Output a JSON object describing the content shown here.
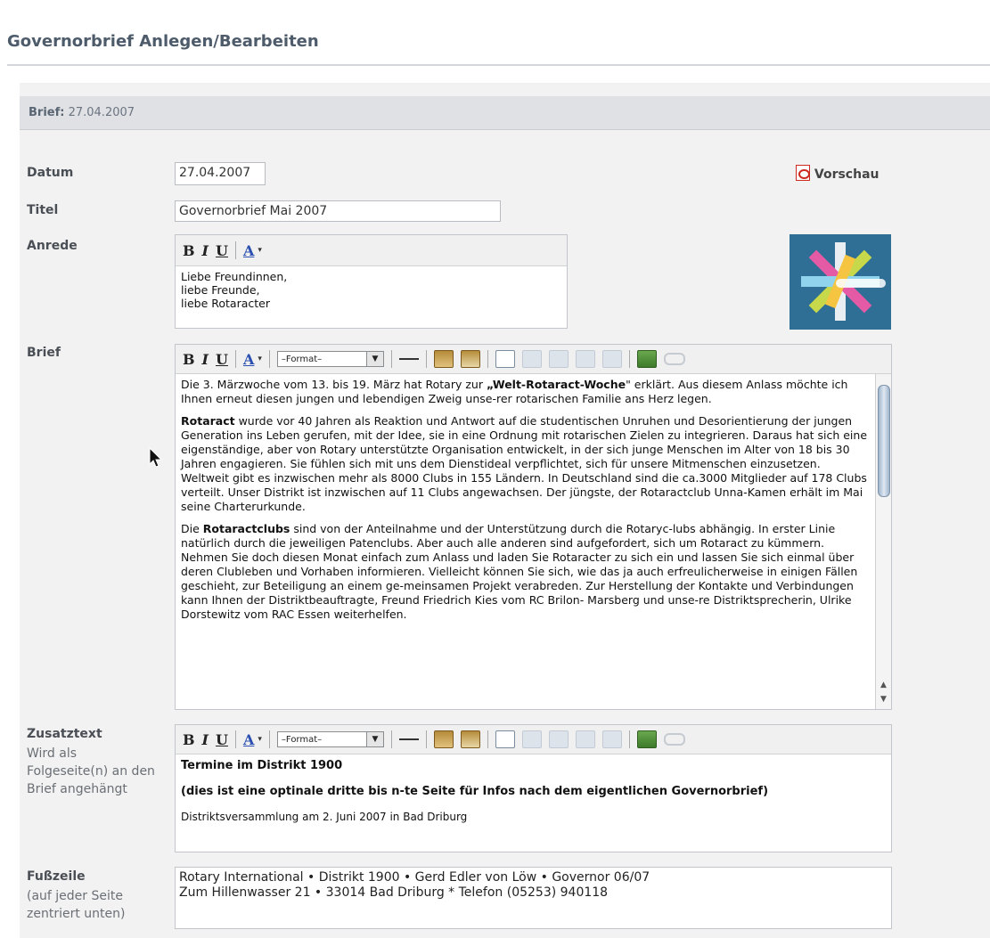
{
  "page": {
    "title": "Governorbrief Anlegen/Bearbeiten"
  },
  "panel": {
    "header_label": "Brief:",
    "header_value": "27.04.2007"
  },
  "form": {
    "datum": {
      "label": "Datum",
      "value": "27.04.2007"
    },
    "preview": {
      "label": "Vorschau",
      "icon": "pdf-icon"
    },
    "titel": {
      "label": "Titel",
      "value": "Governorbrief Mai 2007"
    },
    "anrede": {
      "label": "Anrede",
      "lines": [
        "Liebe Freundinnen,",
        "liebe Freunde,",
        "liebe Rotaracter"
      ]
    },
    "brief": {
      "label": "Brief",
      "format_select": "–Format–",
      "p1_a": "Die 3. Märzwoche vom 13. bis 19. März hat Rotary zur ",
      "p1_b": "„Welt-Rotaract-Woche",
      "p1_c": "\" erklärt. Aus diesem Anlass möchte ich Ihnen erneut diesen jungen und lebendigen Zweig unse-rer rotarischen Familie ans Herz legen.",
      "p2_a": "Rotaract",
      "p2_b": " wurde vor 40 Jahren als Reaktion und Antwort auf die studentischen Unruhen und Desorientierung der jungen Generation ins Leben gerufen, mit der Idee, sie in eine Ordnung mit rotarischen Zielen zu integrieren. Daraus hat sich eine eigenständige, aber von Rotary unterstützte Organisation entwickelt, in der sich junge Menschen im Alter von 18 bis 30 Jahren engagieren. Sie fühlen sich mit uns dem Dienstideal verpflichtet, sich für unsere Mitmenschen einzusetzen. Weltweit gibt es inzwischen mehr als 8000 Clubs in 155 Ländern. In Deutschland sind die ca.3000 Mitglieder auf 178 Clubs verteilt. Unser Distrikt ist inzwischen auf 11 Clubs angewachsen. Der jüngste, der Rotaractclub Unna-Kamen erhält im Mai seine Charterurkunde.",
      "p3_a": "Die ",
      "p3_b": "Rotaractclubs",
      "p3_c": " sind von der Anteilnahme und der Unterstützung durch die Rotaryc-lubs abhängig. In erster Linie natürlich durch die jeweiligen Patenclubs. Aber auch alle anderen sind aufgefordert, sich um Rotaract zu kümmern. Nehmen Sie doch diesen Monat einfach zum Anlass und laden Sie Rotaracter zu sich ein und lassen Sie sich einmal über deren Clubleben und Vorhaben informieren. Vielleicht können Sie sich, wie das ja auch erfreulicherweise in einigen Fällen geschieht, zur Beteiligung an einem ge-meinsamen Projekt verabreden. Zur Herstellung der Kontakte und Verbindungen kann Ihnen der Distriktbeauftragte, Freund Friedrich Kies vom RC Brilon- Marsberg und unse-re Distriktsprecherin, Ulrike Dorstewitz vom RAC Essen weiterhelfen."
    },
    "zusatztext": {
      "label": "Zusatztext",
      "hint": "Wird als Folgeseite(n) an den Brief angehängt",
      "format_select": "–Format–",
      "line1": "Termine im Distrikt 1900",
      "line2": "(dies ist eine optinale dritte bis n-te Seite für Infos nach dem eigentlichen Governorbrief)",
      "line3": "Distriktsversammlung am 2. Juni 2007 in Bad Driburg"
    },
    "fusszeile": {
      "label": "Fußzeile",
      "hint": "(auf jeder Seite zentriert unten)",
      "line1": "Rotary International • Distrikt 1900 • Gerd Edler von Löw • Governor 06/07",
      "line2": "Zum Hillenwasser 21 • 33014 Bad Driburg * Telefon (05253) 940118"
    }
  },
  "toolbar": {
    "bold": "B",
    "italic": "I",
    "underline": "U",
    "color": "A",
    "caret": "▾"
  },
  "colors": {
    "title": "#4d5b6b",
    "panel": "#f2f2f2",
    "header": "#dfe1e4",
    "pdf": "#cc2a1e"
  }
}
